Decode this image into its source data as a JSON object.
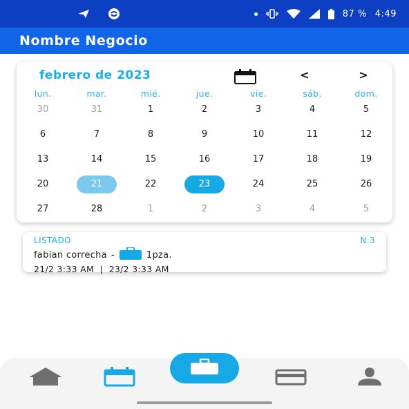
{
  "status_bar": {
    "battery": "87 %",
    "time": "4:49"
  },
  "app_bar": {
    "title": "Nombre Negocio"
  },
  "calendar": {
    "month_title": "febrero de 2023",
    "prev_label": "<",
    "next_label": ">",
    "weekdays": [
      "lun.",
      "mar.",
      "mié.",
      "jue.",
      "vie.",
      "sáb.",
      "dom."
    ],
    "weeks": [
      [
        "30",
        "31",
        "1",
        "2",
        "3",
        "4",
        "5"
      ],
      [
        "6",
        "7",
        "8",
        "9",
        "10",
        "11",
        "12"
      ],
      [
        "13",
        "14",
        "15",
        "16",
        "17",
        "18",
        "19"
      ],
      [
        "20",
        "21",
        "22",
        "23",
        "24",
        "25",
        "26"
      ],
      [
        "27",
        "28",
        "1",
        "2",
        "3",
        "4",
        "5"
      ]
    ]
  },
  "listing": {
    "header": "LISTADO",
    "count": "N.3",
    "client": "fabian correcha",
    "separator": "-",
    "quantity": "1pza.",
    "dates": "21/2 3:33 AM  |  23/2 3:33 AM"
  },
  "colors": {
    "status_bar": "#0c3fc2",
    "app_bar": "#1065e8",
    "accent": "#16a9e6",
    "accent_light": "#7cc9f0",
    "nav_icon": "#6f6f6f"
  },
  "icons": {
    "month_picker": "calendar-icon",
    "fab": "briefcase-icon",
    "nav": [
      "home-icon",
      "calendar-icon",
      "briefcase-icon",
      "credit-card-icon",
      "person-icon"
    ]
  }
}
